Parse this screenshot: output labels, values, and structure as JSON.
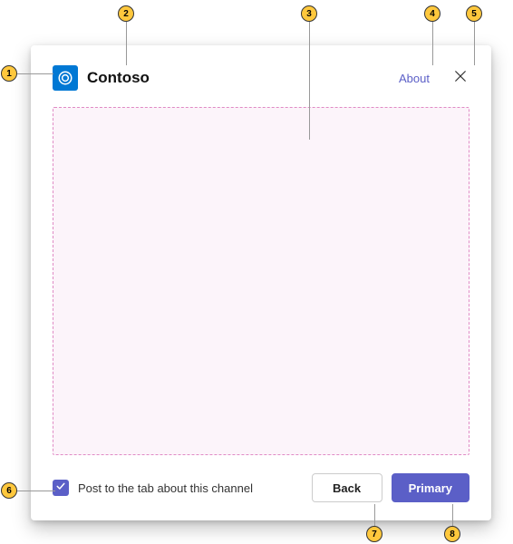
{
  "callouts": {
    "c1": "1",
    "c2": "2",
    "c3": "3",
    "c4": "4",
    "c5": "5",
    "c6": "6",
    "c7": "7",
    "c8": "8"
  },
  "header": {
    "app_name": "Contoso",
    "about_label": "About"
  },
  "footer": {
    "checkbox_label": "Post to the tab about this channel",
    "back_label": "Back",
    "primary_label": "Primary"
  },
  "colors": {
    "accent": "#5b5fc7",
    "logo_bg": "#0078d4",
    "callout_bg": "#ffc83d",
    "iframe_bg": "#fcf4fa",
    "iframe_border": "#e08bc5"
  }
}
